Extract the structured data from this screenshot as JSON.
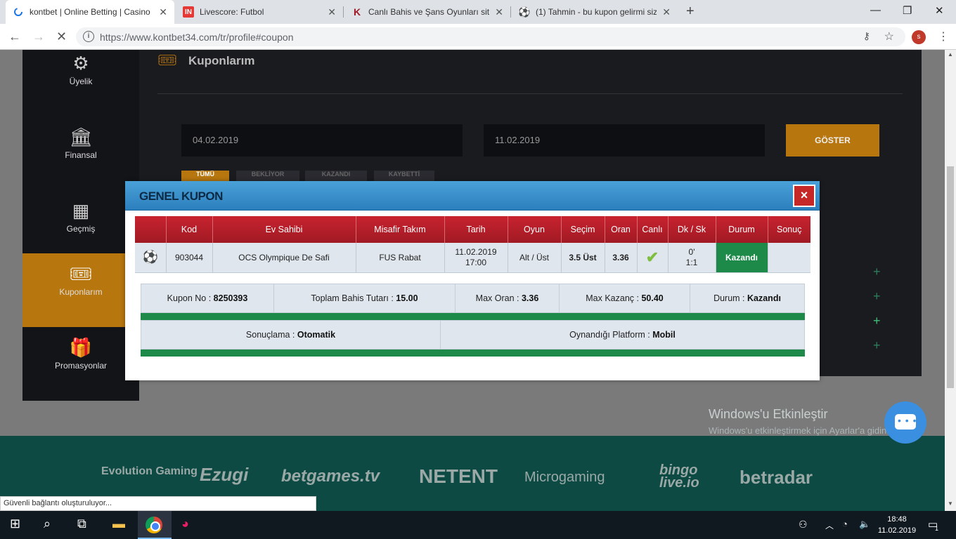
{
  "browser": {
    "tabs": [
      {
        "title": "kontbet | Online Betting | Casino",
        "icon": "loading-icon"
      },
      {
        "title": "Livescore: Futbol",
        "icon": "livescore-icon"
      },
      {
        "title": "Canlı Bahis ve Şans Oyunları sites",
        "icon": "k-logo-icon"
      },
      {
        "title": "(1) Tahmin - bu kupon gelirmi siz",
        "icon": "football-icon"
      }
    ],
    "url_prefix": "https://www.kontbet34.com",
    "url_path": "/tr/profile#coupon",
    "profile_initial": "s",
    "status_text": "Güvenli bağlantı oluşturuluyor..."
  },
  "sidebar": {
    "items": [
      {
        "label": "Üyelik",
        "icon": "gear-icon"
      },
      {
        "label": "Finansal",
        "icon": "bank-icon"
      },
      {
        "label": "Geçmiş",
        "icon": "calendar-icon"
      },
      {
        "label": "Kuponlarım",
        "icon": "ticket-icon",
        "active": true
      },
      {
        "label": "Promasyonlar",
        "icon": "gift-icon"
      }
    ]
  },
  "main": {
    "title": "Kuponlarım",
    "date_from": "04.02.2019",
    "date_to": "11.02.2019",
    "show_button": "GÖSTER",
    "filters": [
      "TÜMÜ",
      "BEKLİYOR",
      "KAZANDI",
      "KAYBETTİ"
    ]
  },
  "modal": {
    "title": "GENEL KUPON",
    "close_label": "×",
    "columns": [
      "",
      "Kod",
      "Ev Sahibi",
      "Misafir Takım",
      "Tarih",
      "Oyun",
      "Seçim",
      "Oran",
      "Canlı",
      "Dk / Sk",
      "Durum",
      "Sonuç"
    ],
    "rows": [
      {
        "sport_icon": "football-icon",
        "kod": "903044",
        "ev_sahibi": "OCS Olympique De Safi",
        "misafir": "FUS Rabat",
        "tarih_date": "11.02.2019",
        "tarih_time": "17:00",
        "oyun": "Alt / Üst",
        "secim": "3.5 Üst",
        "oran": "3.36",
        "canli_icon": "check-icon",
        "dk": "0'",
        "sk": "1:1",
        "durum": "Kazandı",
        "sonuc": ""
      }
    ],
    "summary": {
      "kupon_no_label": "Kupon No : ",
      "kupon_no": "8250393",
      "toplam_label": "Toplam Bahis Tutarı : ",
      "toplam": "15.00",
      "max_oran_label": "Max Oran : ",
      "max_oran": "3.36",
      "max_kazanc_label": "Max Kazanç : ",
      "max_kazanc": "50.40",
      "durum_label": "Durum : ",
      "durum": "Kazandı",
      "sonuclama_label": "Sonuçlama : ",
      "sonuclama": "Otomatik",
      "platform_label": "Oynandığı Platform : ",
      "platform": "Mobil"
    }
  },
  "footer": {
    "logos": [
      "Evolution Gaming",
      "Ezugi",
      "betgames.tv",
      "NETENT",
      "Microgaming",
      "bingo live.io",
      "betradar"
    ],
    "activation_title": "Windows'u Etkinleştir",
    "activation_sub": "Windows'u etkinleştirmek için Ayarlar'a gidin."
  },
  "taskbar": {
    "time": "18:48",
    "date": "11.02.2019",
    "notification_count": "1"
  },
  "colors": {
    "accent": "#b8760e",
    "modal_header": "#2c7fbd",
    "table_header": "#b01e28",
    "win_green": "#1e8a4a"
  }
}
